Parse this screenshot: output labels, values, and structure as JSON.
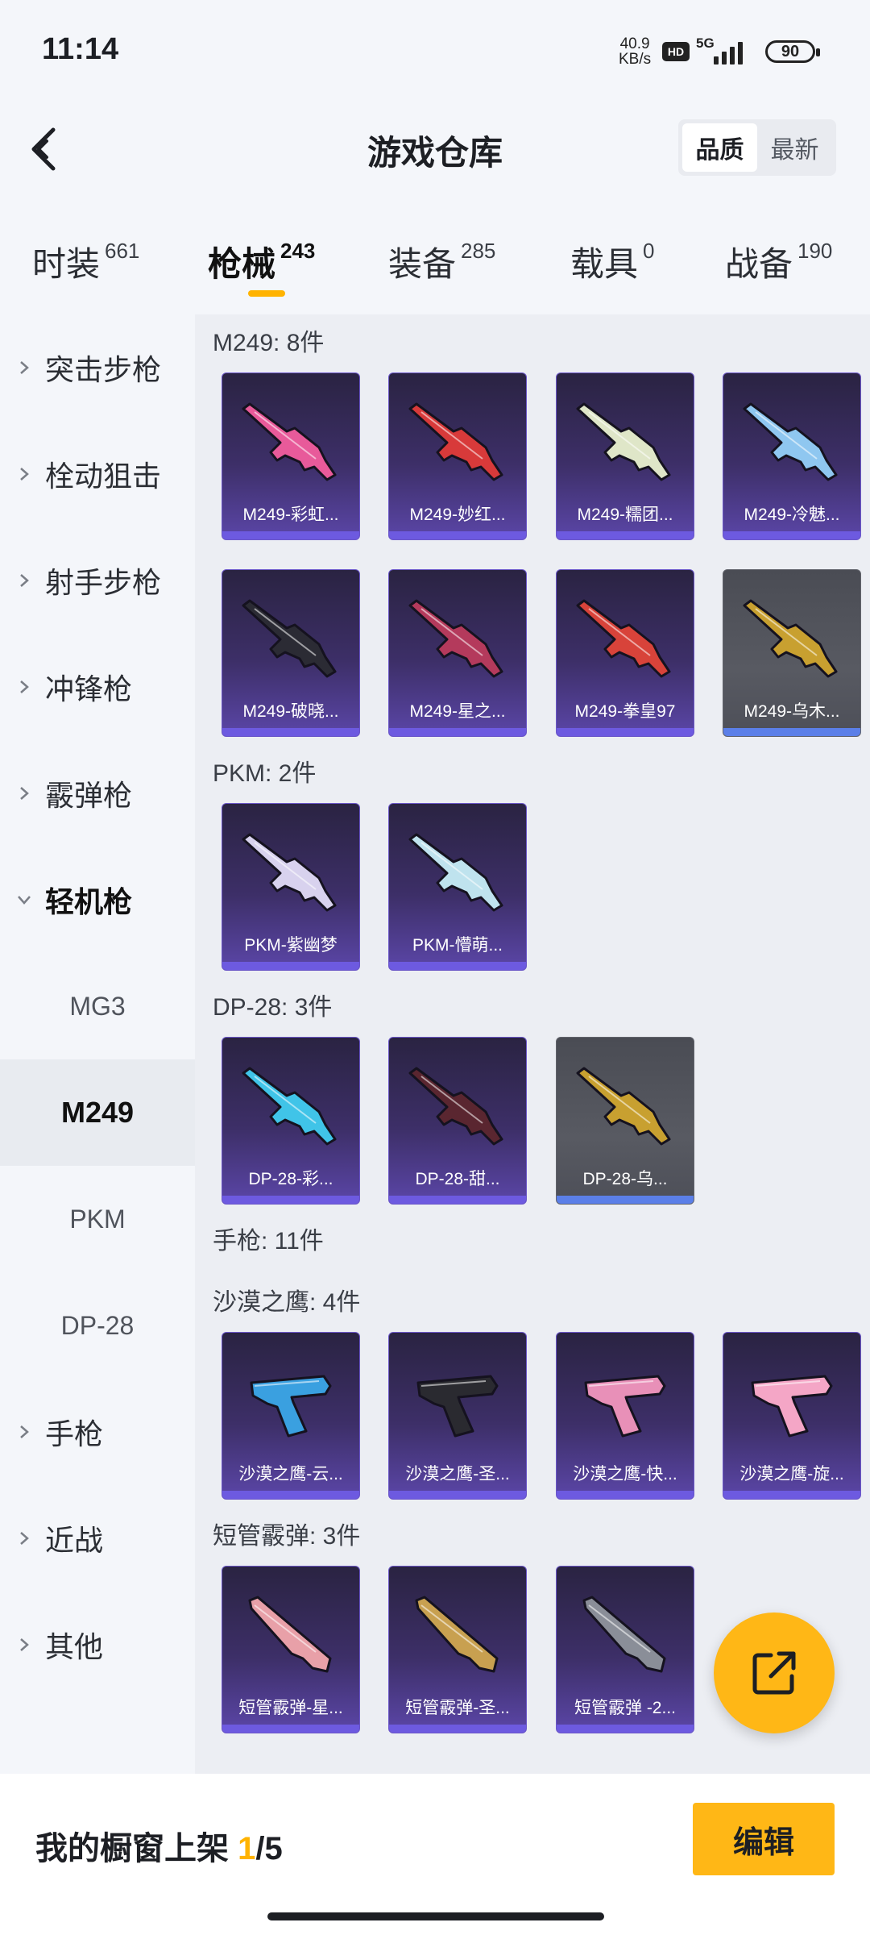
{
  "status_bar": {
    "time": "11:14",
    "net_speed_value": "40.9",
    "net_speed_unit": "KB/s",
    "hd": "HD",
    "signal": "5G",
    "battery": "90"
  },
  "header": {
    "title": "游戏仓库",
    "sort_options": [
      "品质",
      "最新"
    ],
    "active_sort": "品质"
  },
  "tabs": [
    {
      "label": "时装",
      "count": "661"
    },
    {
      "label": "枪械",
      "count": "243",
      "active": true
    },
    {
      "label": "装备",
      "count": "285"
    },
    {
      "label": "载具",
      "count": "0"
    },
    {
      "label": "战备",
      "count": "190"
    }
  ],
  "sidebar": {
    "items": [
      {
        "label": "突击步枪"
      },
      {
        "label": "栓动狙击"
      },
      {
        "label": "射手步枪"
      },
      {
        "label": "冲锋枪"
      },
      {
        "label": "霰弹枪"
      },
      {
        "label": "轻机枪",
        "expanded": true
      },
      {
        "label": "手枪"
      },
      {
        "label": "近战"
      },
      {
        "label": "其他"
      }
    ],
    "sub_items": [
      {
        "label": "MG3"
      },
      {
        "label": "M249",
        "selected": true
      },
      {
        "label": "PKM"
      },
      {
        "label": "DP-28"
      }
    ]
  },
  "sections": [
    {
      "title": "M249: 8件",
      "items": [
        {
          "name": "M249-彩虹...",
          "icon": "lmg-rainbow-icon",
          "accent": "#e85a9a"
        },
        {
          "name": "M249-妙红...",
          "icon": "lmg-red-icon",
          "accent": "#d83a3a"
        },
        {
          "name": "M249-糯团...",
          "icon": "lmg-cream-icon",
          "accent": "#dfe6c8"
        },
        {
          "name": "M249-冷魅...",
          "icon": "lmg-frost-icon",
          "accent": "#8fc7f0"
        },
        {
          "name": "M249-破晓...",
          "icon": "lmg-dawn-icon",
          "accent": "#2b2b34"
        },
        {
          "name": "M249-星之...",
          "icon": "lmg-star-icon",
          "accent": "#b43a5c"
        },
        {
          "name": "M249-拳皇97",
          "icon": "lmg-kof-icon",
          "accent": "#d8433a"
        },
        {
          "name": "M249-乌木...",
          "icon": "lmg-ebony-icon",
          "accent": "#c8a030",
          "grey": true
        }
      ]
    },
    {
      "title": "PKM: 2件",
      "items": [
        {
          "name": "PKM-紫幽梦",
          "icon": "lmg-purple-dream-icon",
          "accent": "#d8d2ee"
        },
        {
          "name": "PKM-懵萌...",
          "icon": "lmg-cute-icon",
          "accent": "#bfe3ee"
        }
      ]
    },
    {
      "title": "DP-28: 3件",
      "items": [
        {
          "name": "DP-28-彩...",
          "icon": "lmg-dp-color-icon",
          "accent": "#40c4e8"
        },
        {
          "name": "DP-28-甜...",
          "icon": "lmg-dp-sweet-icon",
          "accent": "#5a2630"
        },
        {
          "name": "DP-28-乌...",
          "icon": "lmg-dp-ebony-icon",
          "accent": "#c8a030",
          "grey": true
        }
      ]
    },
    {
      "title": "手枪: 11件",
      "items": []
    },
    {
      "title": "沙漠之鹰: 4件",
      "items": [
        {
          "name": "沙漠之鹰-云...",
          "icon": "pistol-cloud-icon",
          "accent": "#3aa0e0"
        },
        {
          "name": "沙漠之鹰-圣...",
          "icon": "pistol-holy-icon",
          "accent": "#2a2a30"
        },
        {
          "name": "沙漠之鹰-快...",
          "icon": "pistol-pink-icon",
          "accent": "#e890b8"
        },
        {
          "name": "沙漠之鹰-旋...",
          "icon": "pistol-swirl-icon",
          "accent": "#f4a6c6"
        }
      ]
    },
    {
      "title": "短管霰弹: 3件",
      "items": [
        {
          "name": "短管霰弹-星...",
          "icon": "shotgun-star-icon",
          "accent": "#e8a0a8"
        },
        {
          "name": "短管霰弹-圣...",
          "icon": "shotgun-holy-icon",
          "accent": "#c8a050"
        },
        {
          "name": "短管霰弹 -2...",
          "icon": "shotgun-dark-icon",
          "accent": "#8a8e98"
        }
      ]
    }
  ],
  "bottom_bar": {
    "label": "我的橱窗上架",
    "current": "1",
    "total": "/5",
    "edit_label": "编辑"
  },
  "colors": {
    "accent": "#ffb716",
    "card_purple": "#3d2f68",
    "card_grey": "#585a62"
  }
}
